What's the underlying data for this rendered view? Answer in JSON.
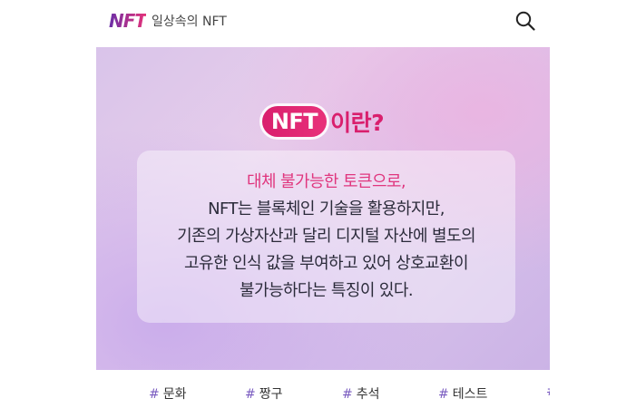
{
  "header": {
    "logo_text": "NFT",
    "title": "일상속의 NFT",
    "search_icon": "search-icon"
  },
  "banner": {
    "headline_pill": "NFT",
    "headline_rest": "이란?",
    "lines": [
      "대체 불가능한 토큰으로,",
      "NFT는 블록체인 기술을 활용하지만,",
      "기존의 가상자산과 달리 디지털 자산에 별도의",
      "고유한 인식 값을 부여하고 있어 상호교환이",
      "불가능하다는 특징이 있다."
    ],
    "accent_color": "#e0367e",
    "pill_color": "#d91f6d"
  },
  "tags": {
    "hash": "#",
    "items": [
      "문화",
      "짱구",
      "추석",
      "테스트",
      ""
    ]
  }
}
